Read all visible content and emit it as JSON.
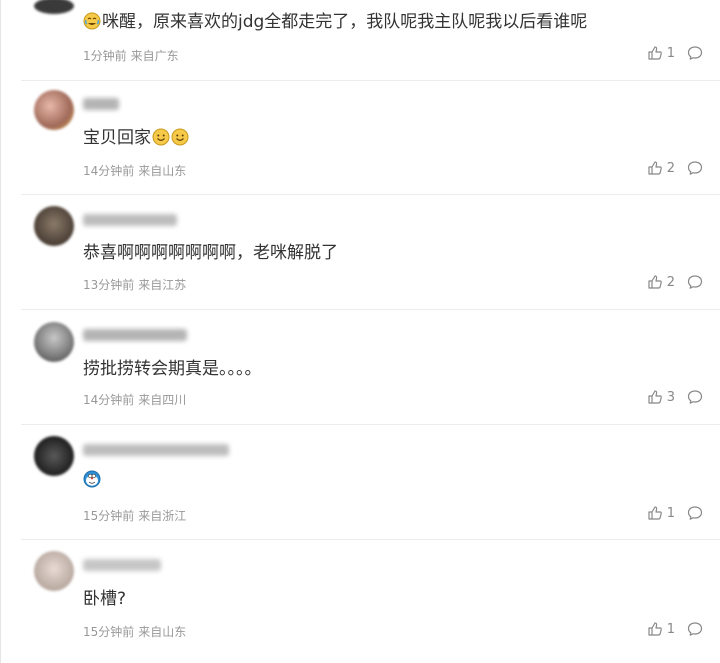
{
  "comments": [
    {
      "text": "咪醒，原来喜欢的jdg全都走完了，我队呢我主队呢我以后看谁呢",
      "time": "1分钟前",
      "location": "来自广东",
      "likes": "1",
      "leading_emoji": "crying-laughing-emoji"
    },
    {
      "text": "宝贝回家",
      "time": "14分钟前",
      "location": "来自山东",
      "likes": "2",
      "trailing_emojis": [
        "smile-emoji",
        "smile-emoji"
      ]
    },
    {
      "text": "恭喜啊啊啊啊啊啊啊，老咪解脱了",
      "time": "13分钟前",
      "location": "来自江苏",
      "likes": "2"
    },
    {
      "text": "捞批捞转会期真是。。。。",
      "time": "14分钟前",
      "location": "来自四川",
      "likes": "3"
    },
    {
      "text": "",
      "time": "15分钟前",
      "location": "来自浙江",
      "likes": "1",
      "sticker": "doraemon-emoji"
    },
    {
      "text": "卧槽?",
      "time": "15分钟前",
      "location": "来自山东",
      "likes": "1"
    }
  ],
  "colors": {
    "text": "#333333",
    "meta": "#999999",
    "divider": "#ececec"
  }
}
